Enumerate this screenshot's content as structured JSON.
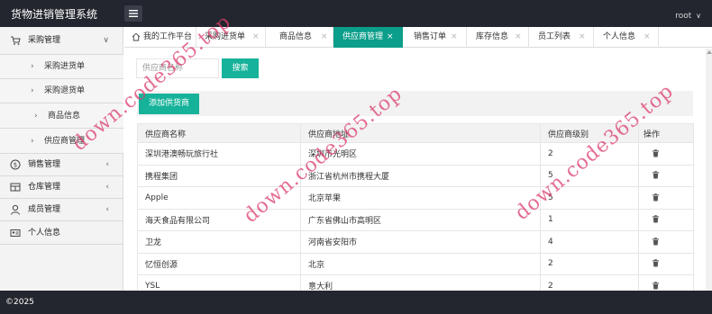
{
  "header": {
    "app_title": "货物进销管理系统",
    "user": "root",
    "user_chevron": "∨",
    "menu_icon": "hamburger-icon"
  },
  "sidebar": {
    "groups": [
      {
        "label": "采购管理",
        "icon": "cart-icon",
        "arrow": "∨",
        "expanded": true,
        "children": [
          "采购进货单",
          "采购退货单",
          "商品信息",
          "供应商管理"
        ]
      },
      {
        "label": "销售管理",
        "icon": "dollar-icon",
        "arrow": "‹"
      },
      {
        "label": "仓库管理",
        "icon": "warehouse-icon",
        "arrow": "‹"
      },
      {
        "label": "成员管理",
        "icon": "user-icon",
        "arrow": "‹"
      },
      {
        "label": "个人信息",
        "icon": "id-card-icon",
        "arrow": ""
      }
    ]
  },
  "tabs": [
    {
      "label": "我的工作平台",
      "icon": "home-icon",
      "closable": false,
      "active": false
    },
    {
      "label": "采购进货单",
      "closable": true,
      "active": false
    },
    {
      "label": "商品信息",
      "closable": true,
      "active": false
    },
    {
      "label": "供应商管理",
      "closable": true,
      "active": true
    },
    {
      "label": "销售订单",
      "closable": true,
      "active": false
    },
    {
      "label": "库存信息",
      "closable": true,
      "active": false
    },
    {
      "label": "员工列表",
      "closable": true,
      "active": false
    },
    {
      "label": "个人信息",
      "closable": true,
      "active": false
    }
  ],
  "tab_close_glyph": "×",
  "search": {
    "placeholder": "供应商名称",
    "button_label": "搜索"
  },
  "toolbar": {
    "add_label": "添加供货商"
  },
  "table": {
    "columns": [
      "供应商名称",
      "供应商地址",
      "供应商级别",
      "操作"
    ],
    "rows": [
      {
        "name": "深圳港澳畅玩旅行社",
        "address": "深圳市光明区",
        "level": "2"
      },
      {
        "name": "携程集团",
        "address": "浙江省杭州市携程大厦",
        "level": "5"
      },
      {
        "name": "Apple",
        "address": "北京苹果",
        "level": "5"
      },
      {
        "name": "海天食品有限公司",
        "address": "广东省佛山市高明区",
        "level": "1"
      },
      {
        "name": "卫龙",
        "address": "河南省安阳市",
        "level": "4"
      },
      {
        "name": "忆恒创源",
        "address": "北京",
        "level": "2"
      },
      {
        "name": "YSL",
        "address": "意大利",
        "level": "2"
      }
    ],
    "delete_icon": "trash-icon"
  },
  "footer": {
    "text": "©2025"
  },
  "watermarks": [
    "down.code365.top",
    "down.code365.top",
    "down.code365.top"
  ],
  "colors": {
    "topbar": "#23262e",
    "accent": "#16b29a",
    "active_tab": "#0b9e8a",
    "watermark": "#db3d6d"
  }
}
